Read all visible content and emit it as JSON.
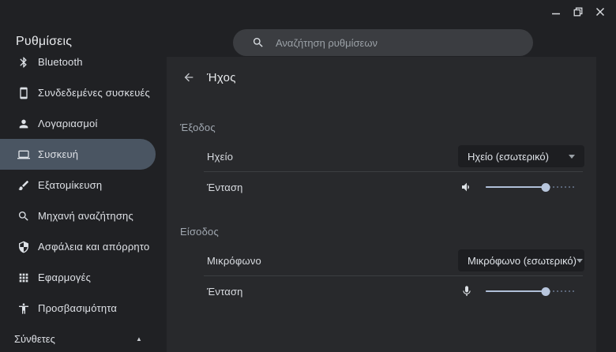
{
  "window": {
    "controls": {
      "minimize": "minimize",
      "restore": "restore",
      "close": "close"
    }
  },
  "header": {
    "title": "Ρυθμίσεις",
    "search_placeholder": "Αναζήτηση ρυθμίσεων"
  },
  "sidebar": {
    "items": [
      {
        "label": "Bluetooth",
        "icon": "bluetooth-icon",
        "selected": false
      },
      {
        "label": "Συνδεδεμένες συσκευές",
        "icon": "connected-devices-icon",
        "selected": false
      },
      {
        "label": "Λογαριασμοί",
        "icon": "person-icon",
        "selected": false
      },
      {
        "label": "Συσκευή",
        "icon": "laptop-icon",
        "selected": true
      },
      {
        "label": "Εξατομίκευση",
        "icon": "brush-icon",
        "selected": false
      },
      {
        "label": "Μηχανή αναζήτησης",
        "icon": "search-icon",
        "selected": false
      },
      {
        "label": "Ασφάλεια και απόρρητο",
        "icon": "shield-icon",
        "selected": false
      },
      {
        "label": "Εφαρμογές",
        "icon": "apps-grid-icon",
        "selected": false
      },
      {
        "label": "Προσβασιμότητα",
        "icon": "accessibility-icon",
        "selected": false
      }
    ],
    "advanced": {
      "label": "Σύνθετες",
      "state": "expanded",
      "icon": "chevron-up-icon"
    }
  },
  "page": {
    "title": "Ήχος",
    "sections": [
      {
        "heading": "Έξοδος",
        "rows": [
          {
            "label": "Ηχείο",
            "control": "dropdown",
            "value": "Ηχείο (εσωτερικό)"
          },
          {
            "label": "Ένταση",
            "control": "slider",
            "icon": "speaker-icon",
            "value_percent": 68
          }
        ]
      },
      {
        "heading": "Είσοδος",
        "rows": [
          {
            "label": "Μικρόφωνο",
            "control": "dropdown",
            "value": "Μικρόφωνο (εσωτερικό)"
          },
          {
            "label": "Ένταση",
            "control": "slider",
            "icon": "microphone-icon",
            "value_percent": 68
          }
        ]
      }
    ]
  },
  "colors": {
    "window_bg": "#202124",
    "content_bg": "#28292c",
    "selected_item_bg": "#4a5562",
    "search_bg": "#3b3d41",
    "dropdown_bg": "#1d1e21",
    "slider_active": "#b0bfd8",
    "slider_inactive": "#5a6578",
    "text_primary": "#e8eaed",
    "text_secondary": "#9aa0a6",
    "divider": "#3c3e42"
  }
}
